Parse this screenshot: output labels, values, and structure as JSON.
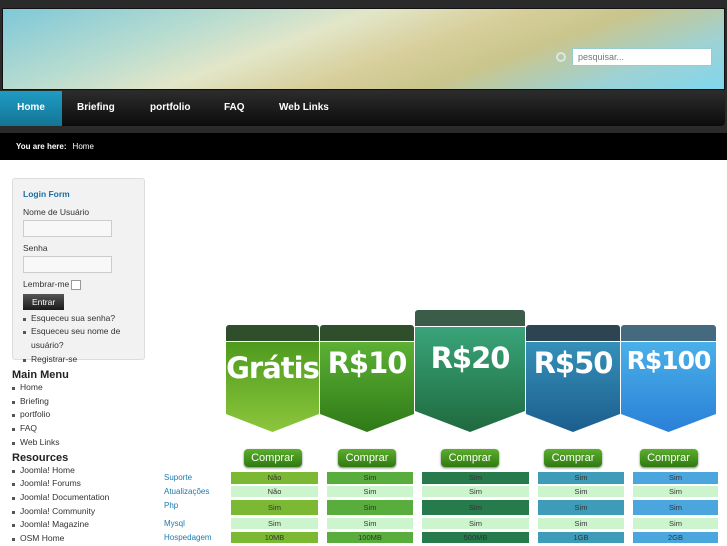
{
  "search": {
    "placeholder": "pesquisar..."
  },
  "nav": [
    {
      "label": "Home"
    },
    {
      "label": "Briefing"
    },
    {
      "label": "portfolio"
    },
    {
      "label": "FAQ"
    },
    {
      "label": "Web Links"
    }
  ],
  "breadcrumb": {
    "label": "You are here:",
    "current": "Home"
  },
  "login": {
    "title": "Login Form",
    "username_label": "Nome de Usuário",
    "password_label": "Senha",
    "remember_label": "Lembrar-me",
    "submit": "Entrar",
    "links": [
      "Esqueceu sua senha?",
      "Esqueceu seu nome de usuário?",
      "Registrar-se"
    ]
  },
  "main_menu": {
    "title": "Main Menu",
    "items": [
      "Home",
      "Briefing",
      "portfolio",
      "FAQ",
      "Web Links"
    ]
  },
  "resources": {
    "title": "Resources",
    "items": [
      "Joomla! Home",
      "Joomla! Forums",
      "Joomla! Documentation",
      "Joomla! Community",
      "Joomla! Magazine",
      "OSM Home"
    ]
  },
  "pricing": {
    "buy_label": "Comprar",
    "rows": [
      "Suporte",
      "Atualizações",
      "Php",
      "Mysql",
      "Hospedagem"
    ],
    "plans": [
      {
        "name": "Grátis",
        "color": "#7bb834",
        "values": [
          "Não",
          "Não",
          "Sim",
          "Sim",
          "10MB"
        ]
      },
      {
        "name": "R$10",
        "color": "#58ad3c",
        "values": [
          "Sim",
          "Sim",
          "Sim",
          "Sim",
          "100MB"
        ]
      },
      {
        "name": "R$20",
        "color": "#267a4c",
        "values": [
          "Sim",
          "Sim",
          "Sim",
          "Sim",
          "500MB"
        ]
      },
      {
        "name": "R$50",
        "color": "#3e9cb8",
        "values": [
          "Sim",
          "Sim",
          "Sim",
          "Sim",
          "1GB"
        ]
      },
      {
        "name": "R$100",
        "color": "#4aa6dc",
        "values": [
          "Sim",
          "Sim",
          "Sim",
          "Sim",
          "2GB"
        ]
      }
    ]
  }
}
